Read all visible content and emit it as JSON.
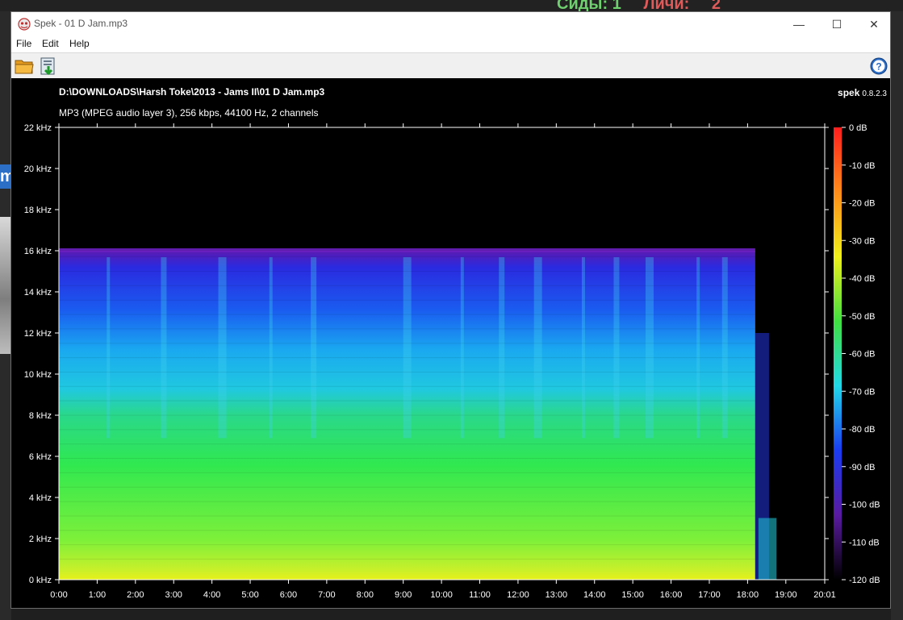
{
  "background": {
    "seeds_label": "Сиды:",
    "seeds_value": "1",
    "leechers_label": "Личи:",
    "leechers_value": "2"
  },
  "window": {
    "title": "Spek - 01 D Jam.mp3",
    "min_glyph": "—",
    "max_glyph": "☐",
    "close_glyph": "✕"
  },
  "menu": {
    "file": "File",
    "edit": "Edit",
    "help": "Help"
  },
  "toolbar": {
    "open_icon": "folder-open-icon",
    "save_icon": "save-icon",
    "about_icon": "help-icon"
  },
  "spectrogram": {
    "file_path": "D:\\DOWNLOADS\\Harsh Toke\\2013 - Jams II\\01 D Jam.mp3",
    "file_info": "MP3 (MPEG audio layer 3), 256 kbps, 44100 Hz, 2 channels",
    "app_name": "spek",
    "version": "0.8.2.3"
  },
  "chart_data": {
    "type": "heatmap",
    "title": "D:\\DOWNLOADS\\Harsh Toke\\2013 - Jams II\\01 D Jam.mp3",
    "subtitle": "MP3 (MPEG audio layer 3), 256 kbps, 44100 Hz, 2 channels",
    "x_ticks": [
      "0:00",
      "1:00",
      "2:00",
      "3:00",
      "4:00",
      "5:00",
      "6:00",
      "7:00",
      "8:00",
      "9:00",
      "10:00",
      "11:00",
      "12:00",
      "13:00",
      "14:00",
      "15:00",
      "16:00",
      "17:00",
      "18:00",
      "19:00",
      "20:01"
    ],
    "x_max_seconds": 1201,
    "y_ticks": [
      "0 kHz",
      "2 kHz",
      "4 kHz",
      "6 kHz",
      "8 kHz",
      "10 kHz",
      "12 kHz",
      "14 kHz",
      "16 kHz",
      "18 kHz",
      "20 kHz",
      "22 kHz"
    ],
    "ylim_khz": [
      0,
      22
    ],
    "colorbar_ticks": [
      "0 dB",
      "-10 dB",
      "-20 dB",
      "-30 dB",
      "-40 dB",
      "-50 dB",
      "-60 dB",
      "-70 dB",
      "-80 dB",
      "-90 dB",
      "-100 dB",
      "-110 dB",
      "-120 dB"
    ],
    "colorbar_range_db": [
      -120,
      0
    ],
    "colorbar_colors": [
      "#ff1e1e",
      "#ff8c1a",
      "#f0f01a",
      "#40e040",
      "#20d8e8",
      "#1a3cf0",
      "#5a1aa0",
      "#000000"
    ],
    "signal_cutoff_khz": 16,
    "signal_end_seconds": 1092,
    "tail_end_seconds": 1128
  }
}
